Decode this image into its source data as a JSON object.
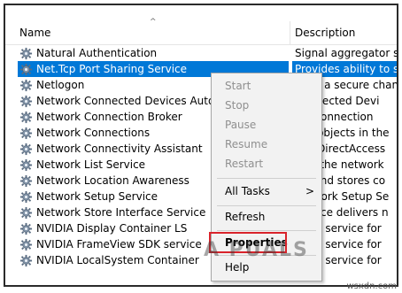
{
  "columns": {
    "name": "Name",
    "description": "Description",
    "sort_indicator": "^"
  },
  "services": [
    {
      "name": "Natural Authentication",
      "description": "Signal aggregator ser",
      "selected": false
    },
    {
      "name": "Net.Tcp Port Sharing Service",
      "description": "Provides ability to sha",
      "selected": true
    },
    {
      "name": "Netlogon",
      "description": "tains a secure chan",
      "selected": false
    },
    {
      "name": "Network Connected Devices Auto",
      "description": "Connected Devi",
      "selected": false
    },
    {
      "name": "Network Connection Broker",
      "description": "ers connection",
      "selected": false
    },
    {
      "name": "Network Connections",
      "description": "ges objects in the",
      "selected": false
    },
    {
      "name": "Network Connectivity Assistant",
      "description": "des DirectAccess",
      "selected": false
    },
    {
      "name": "Network List Service",
      "description": "ifies the network",
      "selected": false
    },
    {
      "name": "Network Location Awareness",
      "description": "cts and stores co",
      "selected": false
    },
    {
      "name": "Network Setup Service",
      "description": "network Setup Se",
      "selected": false
    },
    {
      "name": "Network Store Interface Service",
      "description": "service delivers n",
      "selected": false
    },
    {
      "name": "NVIDIA Display Container LS",
      "description": "ainer service for",
      "selected": false
    },
    {
      "name": "NVIDIA FrameView SDK service",
      "description": "ainer service for",
      "selected": false
    },
    {
      "name": "NVIDIA LocalSystem Container",
      "description": "ainer service for",
      "selected": false
    }
  ],
  "context_menu": {
    "start": "Start",
    "stop": "Stop",
    "pause": "Pause",
    "resume": "Resume",
    "restart": "Restart",
    "all_tasks": "All Tasks",
    "all_tasks_chevron": ">",
    "refresh": "Refresh",
    "properties": "Properties",
    "help": "Help"
  },
  "watermark": "A  PUALS",
  "credit": "wsxdn.com",
  "colors": {
    "selection": "#0078d7",
    "highlight_box": "#d9232b"
  },
  "icons": {
    "service": "gear-icon"
  }
}
